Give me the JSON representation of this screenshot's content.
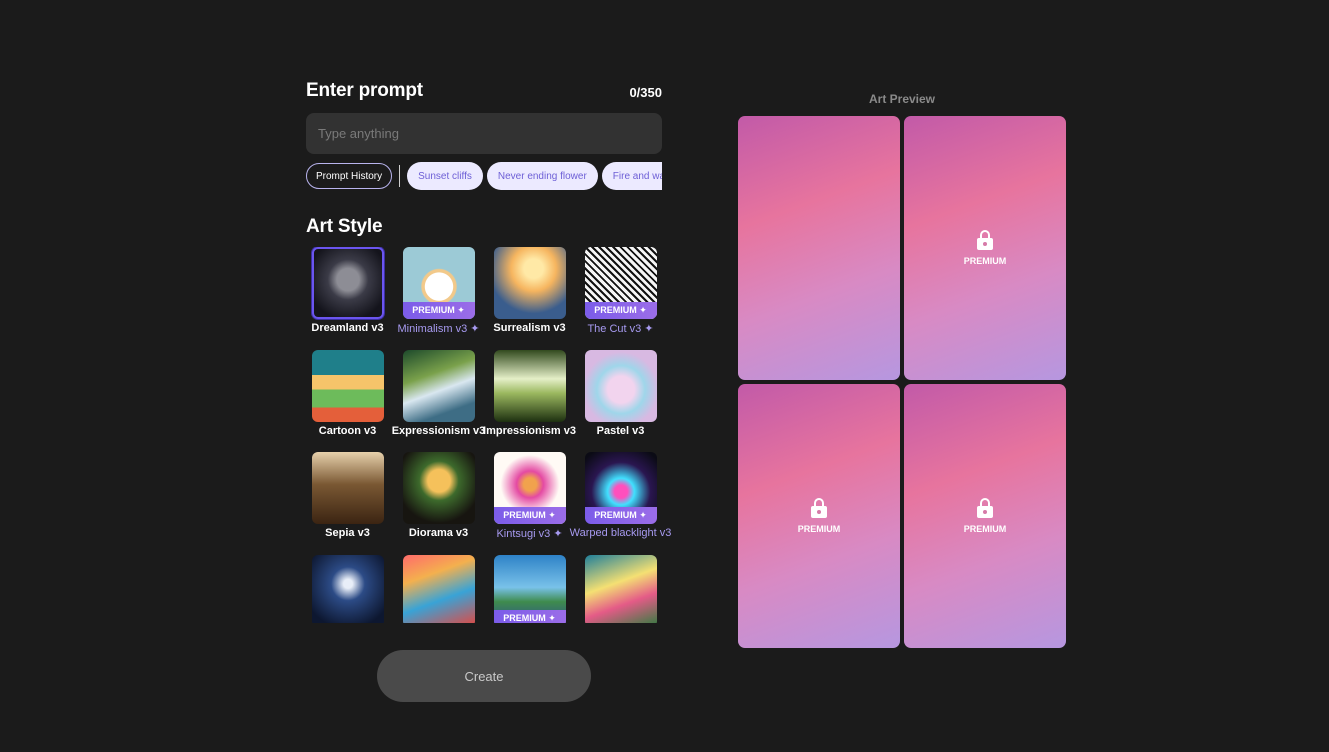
{
  "prompt": {
    "title": "Enter prompt",
    "counter": "0/350",
    "value": "",
    "placeholder": "Type anything"
  },
  "chips": {
    "history": "Prompt History",
    "suggestions": [
      "Sunset cliffs",
      "Never ending flower",
      "Fire and water"
    ]
  },
  "art_style": {
    "title": "Art Style",
    "premium_badge": "PREMIUM",
    "styles": [
      {
        "label": "Dreamland v3",
        "premium": false,
        "selected": true
      },
      {
        "label": "Minimalism v3 ✦",
        "premium": true
      },
      {
        "label": "Surrealism v3",
        "premium": false
      },
      {
        "label": "The Cut v3 ✦",
        "premium": true
      },
      {
        "label": "Cartoon v3",
        "premium": false
      },
      {
        "label": "Expressionism v3",
        "premium": false
      },
      {
        "label": "Impressionism v3",
        "premium": false
      },
      {
        "label": "Pastel v3",
        "premium": false
      },
      {
        "label": "Sepia v3",
        "premium": false
      },
      {
        "label": "Diorama v3",
        "premium": false
      },
      {
        "label": "Kintsugi v3 ✦",
        "premium": true
      },
      {
        "label": "Warped blacklight v3",
        "premium": true
      },
      {
        "label": "",
        "premium": false
      },
      {
        "label": "",
        "premium": false
      },
      {
        "label": "",
        "premium": true
      },
      {
        "label": "",
        "premium": false
      }
    ]
  },
  "create_label": "Create",
  "preview": {
    "title": "Art Preview",
    "cards": [
      {
        "locked": false,
        "label": ""
      },
      {
        "locked": true,
        "label": "PREMIUM"
      },
      {
        "locked": true,
        "label": "PREMIUM"
      },
      {
        "locked": true,
        "label": "PREMIUM"
      }
    ]
  },
  "colors": {
    "background": "#1b1b1b",
    "accent": "#6b55f0",
    "premium_text": "#a79af0",
    "chip_bg": "#eceaff"
  }
}
